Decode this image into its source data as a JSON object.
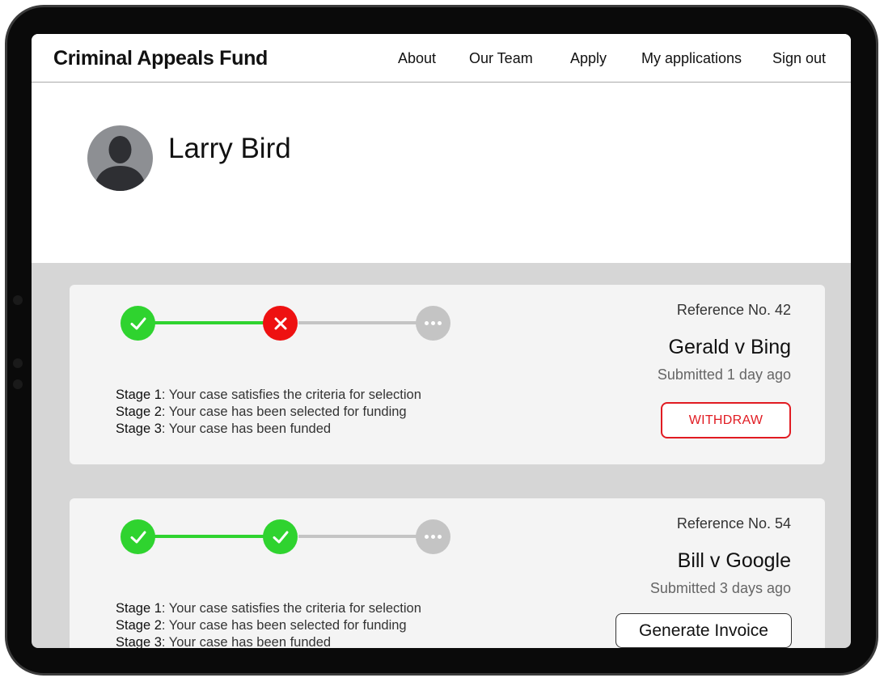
{
  "header": {
    "brand": "Criminal Appeals Fund",
    "nav": [
      "About",
      "Our Team",
      "Apply",
      "My applications",
      "Sign out"
    ]
  },
  "profile": {
    "name": "Larry Bird"
  },
  "applications": [
    {
      "reference": "Reference No. 42",
      "title": "Gerald v Bing",
      "submitted": "Submitted 1 day ago",
      "stage_status": [
        "complete",
        "failed",
        "pending"
      ],
      "stages": [
        {
          "label": "Stage 1",
          "text": ": Your case satisfies the criteria for selection"
        },
        {
          "label": "Stage 2",
          "text": ": Your case has been selected for funding"
        },
        {
          "label": "Stage 3",
          "text": ": Your case has been funded"
        }
      ],
      "action": "WITHDRAW"
    },
    {
      "reference": "Reference No. 54",
      "title": "Bill v Google",
      "submitted": "Submitted 3 days ago",
      "stage_status": [
        "complete",
        "complete",
        "pending"
      ],
      "stages": [
        {
          "label": "Stage 1",
          "text": ": Your case satisfies the criteria for selection"
        },
        {
          "label": "Stage 2",
          "text": ": Your case has been selected for funding"
        },
        {
          "label": "Stage 3",
          "text": ": Your case has been funded"
        }
      ],
      "action": "Generate Invoice"
    }
  ],
  "colors": {
    "complete": "#2fd32f",
    "failed": "#ee1111",
    "pending": "#c4c4c4",
    "withdraw": "#e11b22"
  },
  "icons": {
    "complete": "check-icon",
    "failed": "cross-icon",
    "pending": "more-dots-icon",
    "avatar": "person-silhouette-icon"
  }
}
